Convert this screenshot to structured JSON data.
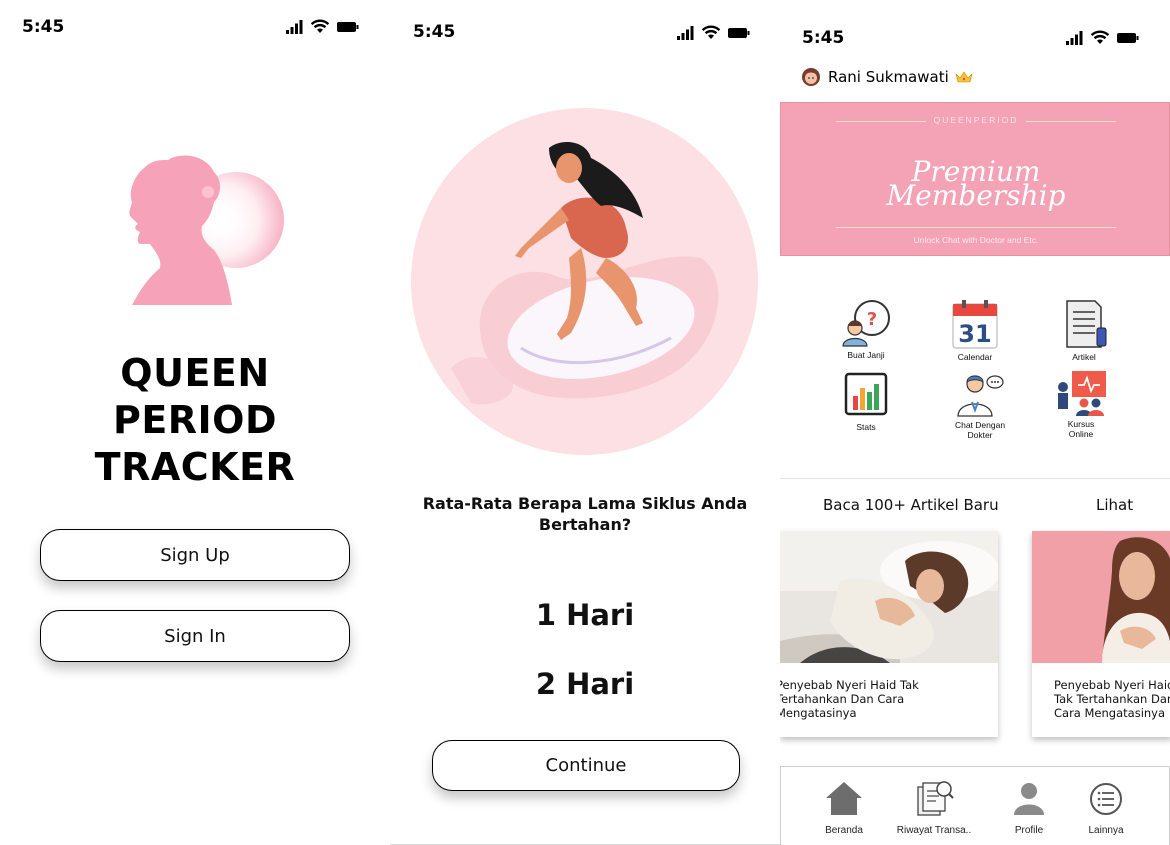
{
  "status_bar": {
    "time": "5:45"
  },
  "welcome": {
    "title_lines": [
      "QUEEN",
      "PERIOD",
      "TRACKER"
    ],
    "signup_label": "Sign Up",
    "signin_label": "Sign In"
  },
  "onboarding": {
    "question": "Rata-Rata Berapa Lama Siklus Anda Bertahan?",
    "options": [
      "1 Hari",
      "2 Hari"
    ],
    "continue_label": "Continue"
  },
  "home": {
    "user_name": "Rani Sukmawati",
    "banner": {
      "brand": "QUEENPERIOD",
      "title_line1": "Premium",
      "title_line2": "Membership",
      "subtitle": "Unlock Chat with Doctor and Etc."
    },
    "menu": [
      {
        "label": "Buat Janji",
        "icon": "appointment-icon"
      },
      {
        "label": "Calendar",
        "icon": "calendar-icon",
        "day": "31"
      },
      {
        "label": "Artikel",
        "icon": "article-icon"
      },
      {
        "label": "Stats",
        "icon": "stats-icon"
      },
      {
        "label": "Chat Dengan Dokter",
        "icon": "doctor-chat-icon"
      },
      {
        "label": "Kursus Online",
        "icon": "online-course-icon"
      }
    ],
    "articles_heading": "Baca 100+ Artikel Baru",
    "see_all": "Lihat",
    "articles": [
      {
        "title": "Penyebab Nyeri Haid Tak Tertahankan Dan Cara Mengatasinya"
      },
      {
        "title": "Penyebab Nyeri Haid Tak Tertahankan Dan Cara Mengatasinya"
      }
    ],
    "nav": [
      {
        "label": "Beranda",
        "icon": "home-icon"
      },
      {
        "label": "Riwayat Transa..",
        "icon": "history-icon"
      },
      {
        "label": "Profile",
        "icon": "profile-icon"
      },
      {
        "label": "Lainnya",
        "icon": "more-icon"
      }
    ]
  },
  "colors": {
    "brand_pink": "#f4a2b6",
    "logo_pink": "#f6a3b9",
    "illustration_bg": "#fde0e4"
  }
}
